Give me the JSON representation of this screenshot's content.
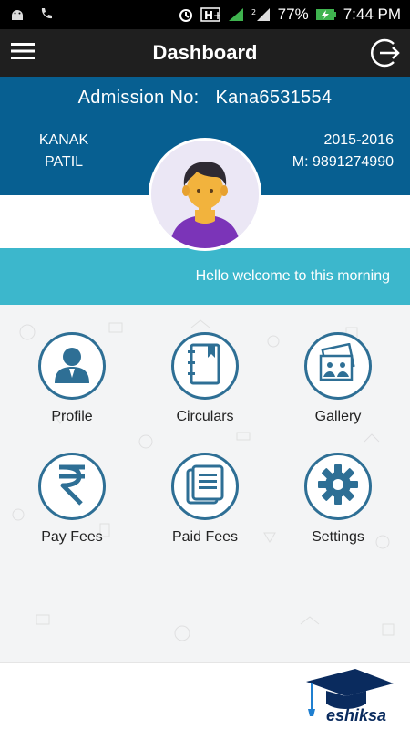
{
  "status_bar": {
    "battery_percent": "77%",
    "time": "7:44 PM",
    "icons": [
      "android-icon",
      "phone-icon",
      "alarm-icon",
      "h-plus-icon",
      "signal-icon",
      "signal-2-icon",
      "battery-charging-icon"
    ]
  },
  "toolbar": {
    "title": "Dashboard",
    "menu_icon": "hamburger-icon",
    "logout_icon": "logout-icon"
  },
  "profile": {
    "admission_label": "Admission No:",
    "admission_no": "Kana6531554",
    "first_name": "KANAK",
    "last_name": "PATIL",
    "session": "2015-2016",
    "mobile": "M: 9891274990"
  },
  "welcome": {
    "message": "Hello welcome to this morning"
  },
  "menu": {
    "items": [
      {
        "label": "Profile",
        "icon": "user-icon"
      },
      {
        "label": "Circulars",
        "icon": "book-icon"
      },
      {
        "label": "Gallery",
        "icon": "gallery-icon"
      },
      {
        "label": "Pay Fees",
        "icon": "rupee-icon"
      },
      {
        "label": "Paid Fees",
        "icon": "document-icon"
      },
      {
        "label": "Settings",
        "icon": "gear-icon"
      }
    ]
  },
  "footer": {
    "brand": "eshiksa"
  },
  "colors": {
    "header_blue": "#075f91",
    "welcome_teal": "#3cb7cc",
    "icon_blue": "#2e6f95",
    "toolbar": "#1f1f1f"
  }
}
